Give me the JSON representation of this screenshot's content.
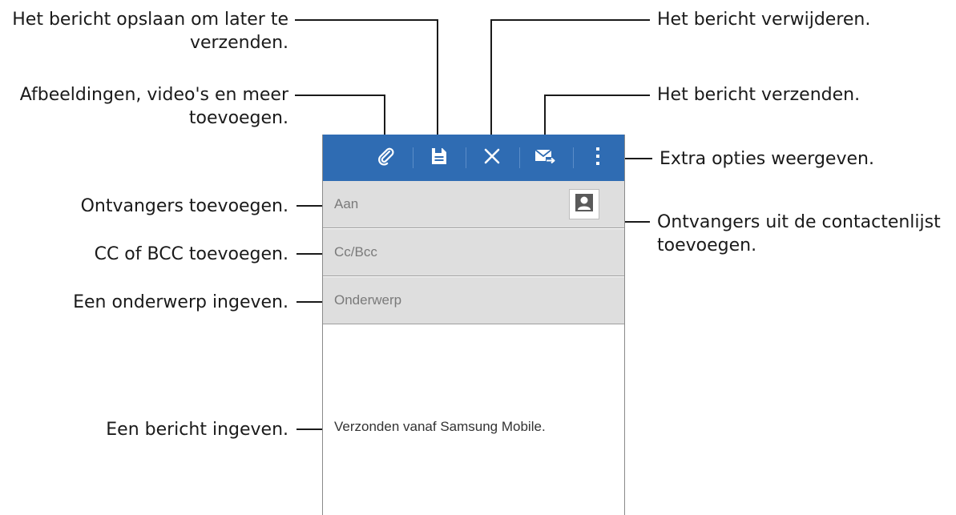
{
  "callouts": {
    "save": [
      "Het bericht opslaan om later te",
      "verzenden."
    ],
    "attach": [
      "Afbeeldingen, video's en meer",
      "toevoegen."
    ],
    "recipients": "Ontvangers toevoegen.",
    "cc_bcc": "CC of BCC toevoegen.",
    "subject": "Een onderwerp ingeven.",
    "message": "Een bericht ingeven.",
    "delete": "Het bericht verwijderen.",
    "send": "Het bericht verzenden.",
    "more": "Extra opties weergeven.",
    "contacts": [
      "Ontvangers uit de contactenlijst",
      "toevoegen."
    ]
  },
  "actionbar": {
    "color": "#2f6cb3",
    "icons": [
      "paperclip-icon",
      "save-icon",
      "close-icon",
      "send-mail-icon",
      "more-vert-icon"
    ]
  },
  "form": {
    "to_placeholder": "Aan",
    "cc_placeholder": "Cc/Bcc",
    "subject_placeholder": "Onderwerp",
    "body_value": "Verzonden vanaf Samsung Mobile.",
    "contact_icon": "contact-person-icon"
  }
}
